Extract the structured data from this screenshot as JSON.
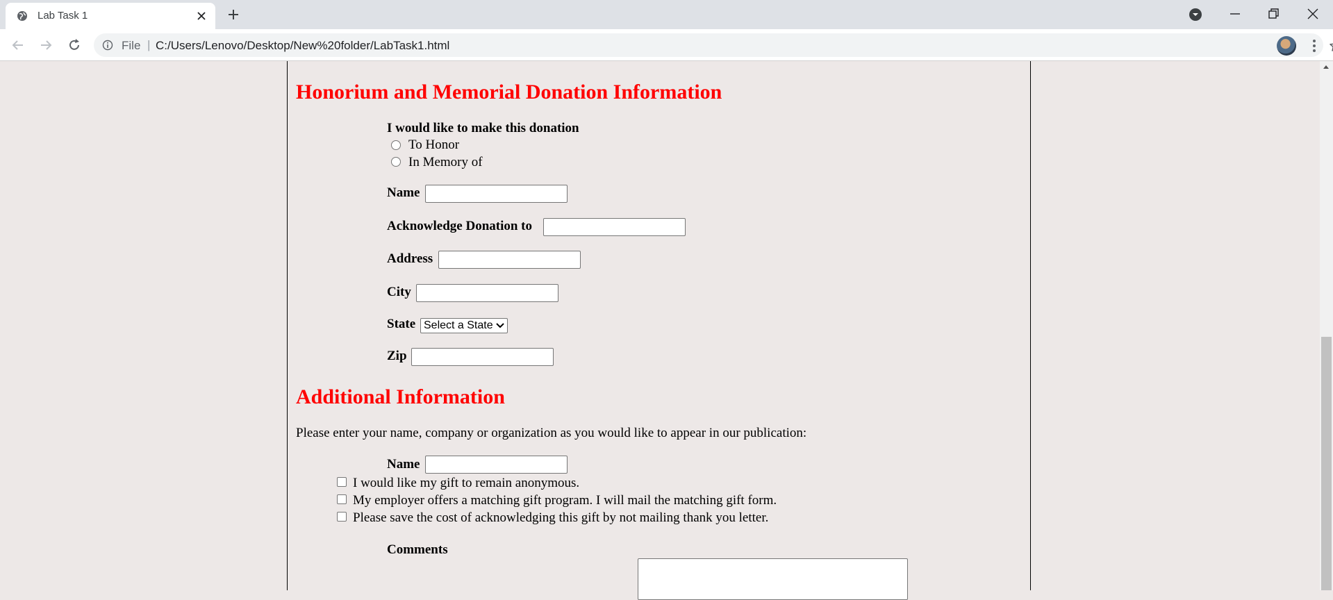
{
  "browser": {
    "tab_title": "Lab Task 1",
    "omnibox_file_label": "File",
    "omnibox_separator": "|",
    "url": "C:/Users/Lenovo/Desktop/New%20folder/LabTask1.html"
  },
  "honorium": {
    "heading": "Honorium and Memorial Donation Information",
    "donation_prompt": "I would like to make this donation",
    "options": [
      "To Honor",
      "In Memory of"
    ],
    "name_label": "Name",
    "acknowledge_label": "Acknowledge Donation to",
    "address_label": "Address",
    "city_label": "City",
    "state_label": "State",
    "state_select_value": "Select a State",
    "zip_label": "Zip"
  },
  "additional": {
    "heading": "Additional Information",
    "instruction": "Please enter your name, company or organization as you would like to appear in our publication:",
    "name_label": "Name",
    "checkboxes": [
      "I would like my gift to remain anonymous.",
      "My employer offers a matching gift program. I will mail the matching gift form.",
      "Please save the cost of acknowledging this gift by not mailing thank you letter."
    ],
    "comments_label": "Comments"
  },
  "colors": {
    "heading": "#ff0000",
    "page_background": "#ede8e7"
  }
}
